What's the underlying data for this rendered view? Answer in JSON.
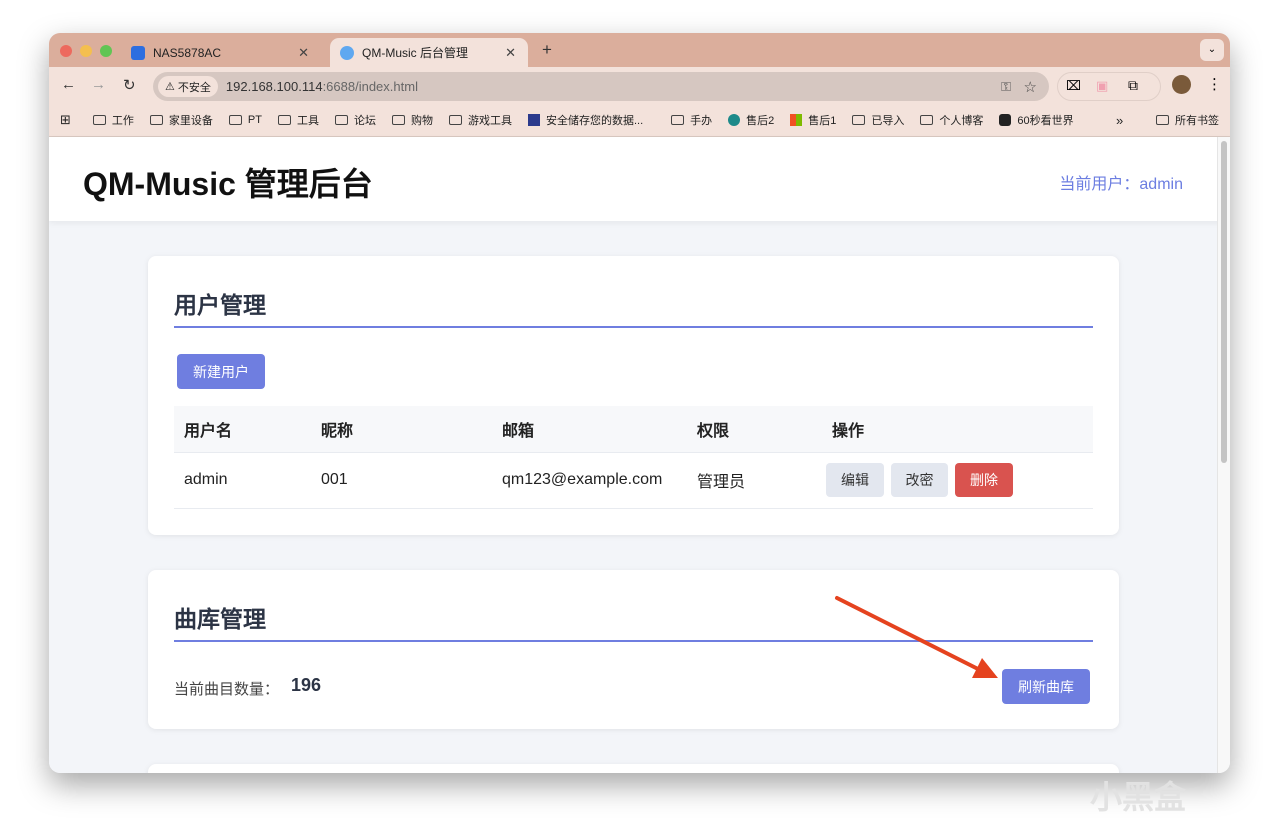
{
  "browser": {
    "tabs": [
      {
        "label": "NAS5878AC",
        "active": false
      },
      {
        "label": "QM-Music 后台管理",
        "active": true
      }
    ],
    "new_tab": "+",
    "security_label": "不安全",
    "url_host": "192.168.100.114",
    "url_rest": ":6688/index.html",
    "bookmarks": [
      "工作",
      "家里设备",
      "PT",
      "工具",
      "论坛",
      "购物",
      "游戏工具",
      "安全储存您的数据...",
      "手办",
      "售后2",
      "售后1",
      "已导入",
      "个人博客",
      "60秒看世界"
    ],
    "more": "»",
    "all_bookmarks": "所有书签"
  },
  "page": {
    "title": "QM-Music 管理后台",
    "current_user": "当前用户：admin"
  },
  "users": {
    "heading": "用户管理",
    "new_user": "新建用户",
    "columns": [
      "用户名",
      "昵称",
      "邮箱",
      "权限",
      "操作"
    ],
    "rows": [
      {
        "username": "admin",
        "nickname": "001",
        "email": "qm123@example.com",
        "role": "管理员"
      }
    ],
    "actions": {
      "edit": "编辑",
      "password": "改密",
      "delete": "删除"
    }
  },
  "library": {
    "heading": "曲库管理",
    "count_label": "当前曲目数量：",
    "count": "196",
    "refresh": "刷新曲库"
  },
  "watermark": "小黑盒",
  "colors": {
    "accent": "#6f7ee0",
    "danger": "#d9534f",
    "arrow": "#e5431f"
  }
}
